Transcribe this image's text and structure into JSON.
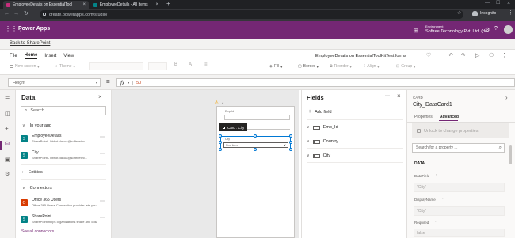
{
  "browser": {
    "tabs": [
      {
        "label": "EmployeeDetails on EssentialTool"
      },
      {
        "label": "EmployeeDetails - All Items"
      }
    ],
    "url": "create.powerapps.com/studio/",
    "profile": "Incognito"
  },
  "appbar": {
    "title": "Power Apps",
    "env_label": "Environment",
    "env_name": "Softree Technology Pvt. Ltd. (de..."
  },
  "back_link": "Back to SharePoint",
  "menu": {
    "items": [
      "File",
      "Home",
      "Insert",
      "View"
    ],
    "app_title": "EmployeeDetails on EssentialToolKitTest forms",
    "new_screen": "New screen",
    "theme": "Theme",
    "fill": "Fill",
    "border": "Border",
    "reorder": "Reorder",
    "align": "Align",
    "group": "Group"
  },
  "formula": {
    "property": "Height",
    "equals": "=",
    "fx": "fx",
    "value": "50"
  },
  "data_panel": {
    "title": "Data",
    "search_placeholder": "Search",
    "in_your_app": "In your app",
    "sources": [
      {
        "name": "EmployeeDetails",
        "desc": "SharePoint - bbhot.dakua@softreetec..."
      },
      {
        "name": "City",
        "desc": "SharePoint - bbhot.dakua@softreetec..."
      }
    ],
    "entities": "Entities",
    "connectors": "Connectors",
    "connector_items": [
      {
        "name": "Office 365 Users",
        "desc": "Office 365 Users Connection provider lets you..."
      },
      {
        "name": "SharePoint",
        "desc": "SharePoint helps organizations share and colla..."
      }
    ],
    "see_all": "See all connectors"
  },
  "canvas": {
    "field_label": "Emp Id",
    "card_tooltip": "Card : City",
    "city_label": "City",
    "city_value": "Find items"
  },
  "fields_panel": {
    "title": "Fields",
    "add_field": "Add field",
    "fields": [
      "Emp_Id",
      "Country",
      "City"
    ]
  },
  "card_panel": {
    "type_label": "CARD",
    "name": "City_DataCard1",
    "tabs": [
      "Properties",
      "Advanced"
    ],
    "unlock": "Unlock to change properties.",
    "search_placeholder": "Search for a property ...",
    "section": "DATA",
    "datafield_label": "DataField",
    "datafield_value": "\"City\"",
    "displayname_label": "DisplayName",
    "displayname_value": "\"City\"",
    "required_label": "Required",
    "required_value": "false"
  },
  "colors": {
    "brand": "#742774",
    "accent": "#0078d4"
  }
}
